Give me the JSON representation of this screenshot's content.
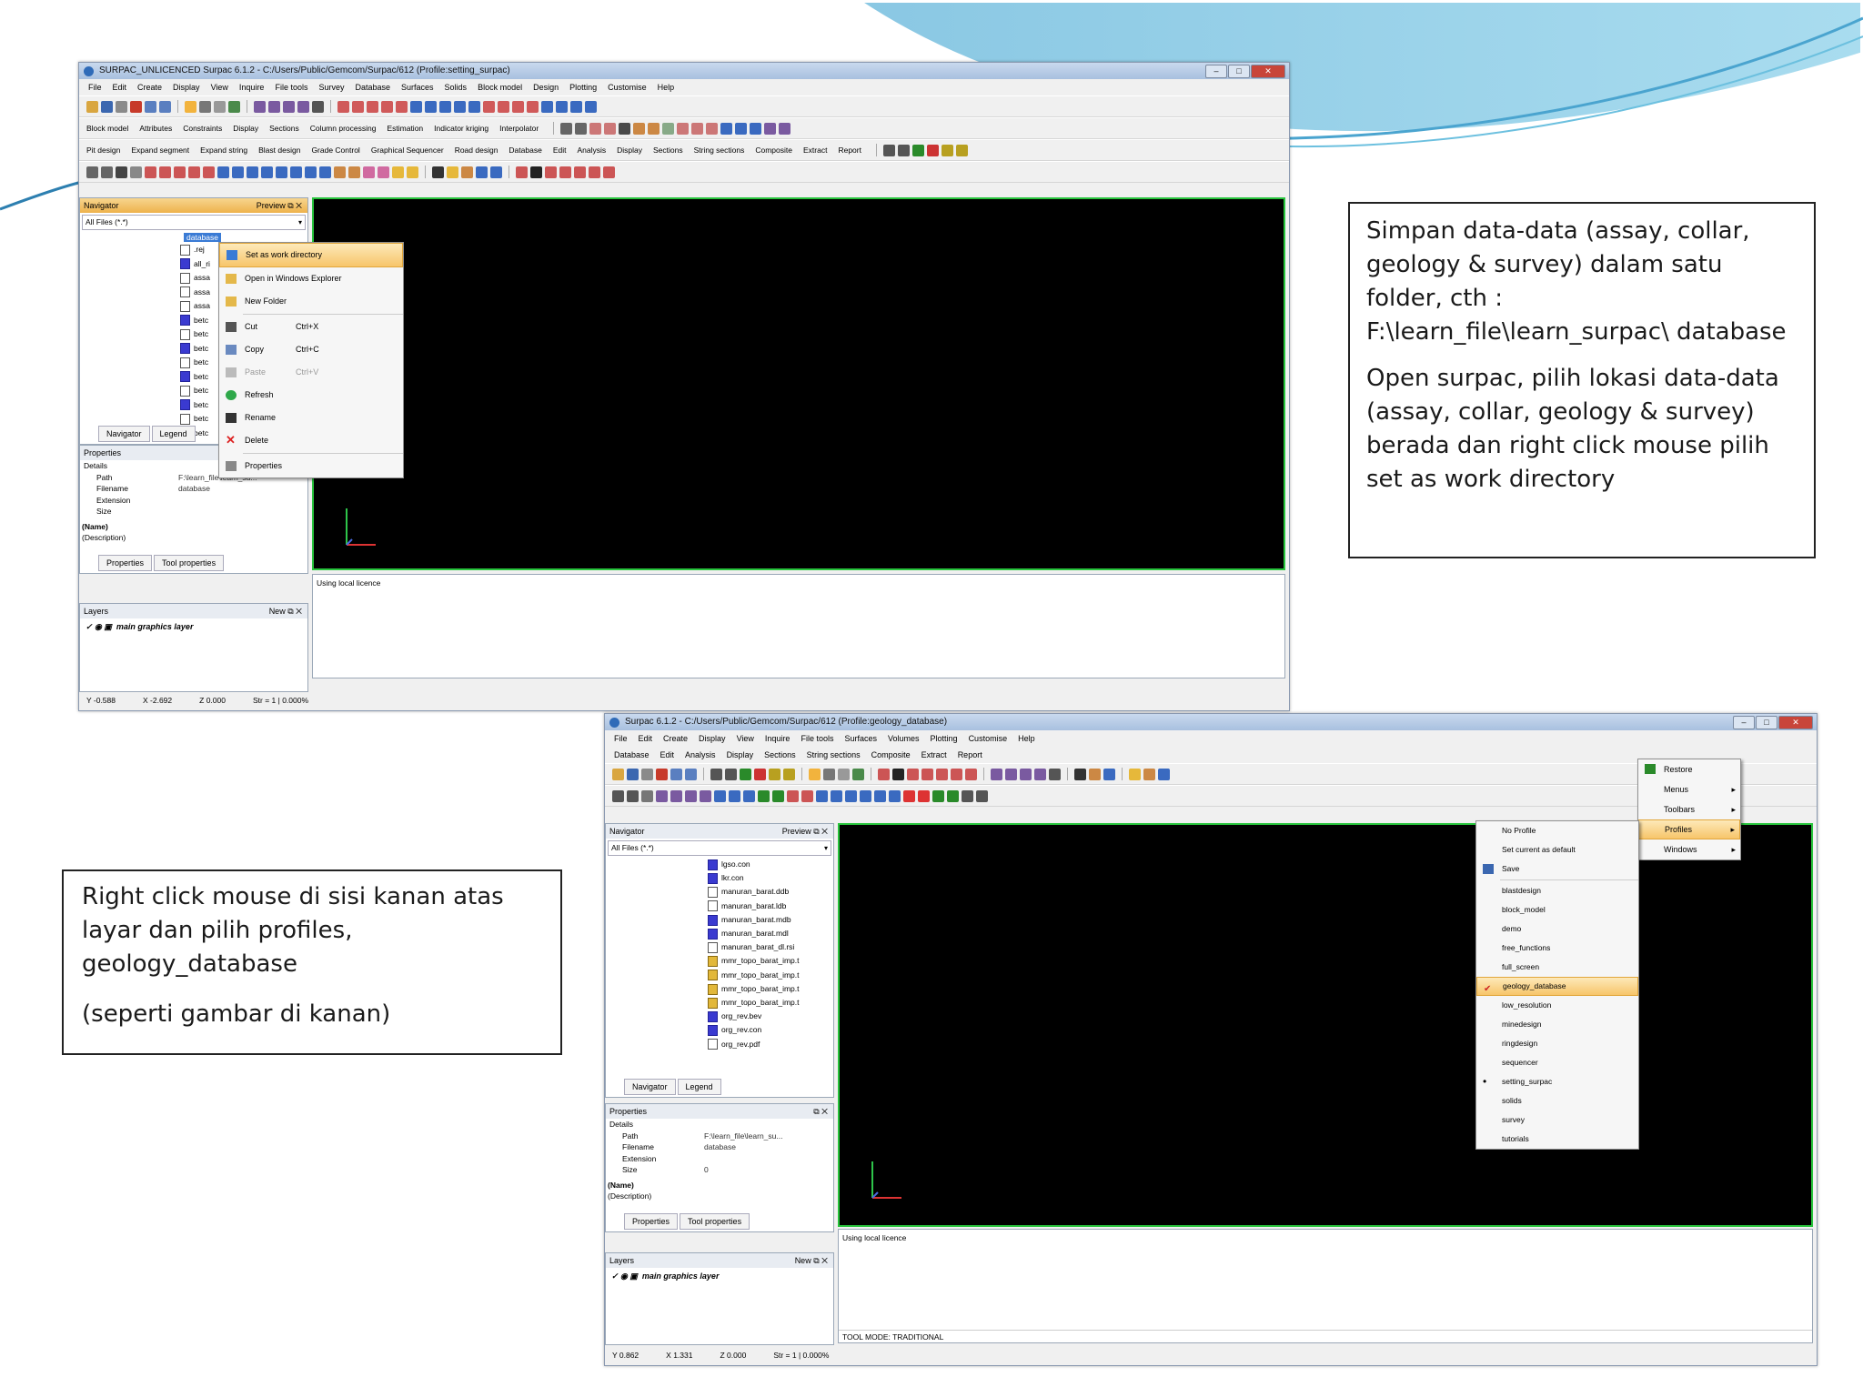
{
  "colors": {
    "wave_light": "#c7e9f5",
    "wave_mid": "#79c3df",
    "graphics_border": "#27c43c",
    "menu_highlight": "#f7c56a"
  },
  "window1": {
    "title": "SURPAC_UNLICENCED Surpac 6.1.2 - C:/Users/Public/Gemcom/Surpac/612 (Profile:setting_surpac)",
    "menus": [
      "File",
      "Edit",
      "Create",
      "Display",
      "View",
      "Inquire",
      "File tools",
      "Survey",
      "Database",
      "Surfaces",
      "Solids",
      "Block model",
      "Design",
      "Plotting",
      "Customise",
      "Help"
    ],
    "toolbar_row3": [
      "Block model",
      "Attributes",
      "Constraints",
      "Display",
      "Sections",
      "Column processing",
      "Estimation",
      "Indicator kriging",
      "Interpolator"
    ],
    "toolbar_row4": [
      "Pit design",
      "Expand segment",
      "Expand string",
      "Blast design",
      "Grade Control",
      "Graphical Sequencer",
      "Road design",
      "Database",
      "Edit",
      "Analysis",
      "Display",
      "Sections",
      "String sections",
      "Composite",
      "Extract",
      "Report"
    ],
    "navigator": {
      "title": "Navigator",
      "preview": "Preview",
      "filter": "All Files (*.*)",
      "folder": "database",
      "files": [
        ".rej",
        "all_ri",
        "assa",
        "assa",
        "assa",
        "betc",
        "betc",
        "betc",
        "betc",
        "betc",
        "betc",
        "betc",
        "betc",
        "betc"
      ]
    },
    "context_menu": {
      "items": [
        {
          "label": "Set as work directory",
          "shortcut": "",
          "highlight": true,
          "disabled": false
        },
        {
          "label": "Open in Windows Explorer",
          "shortcut": "",
          "highlight": false,
          "disabled": false
        },
        {
          "label": "New Folder",
          "shortcut": "",
          "highlight": false,
          "disabled": false
        },
        {
          "label": "Cut",
          "shortcut": "Ctrl+X",
          "highlight": false,
          "disabled": false
        },
        {
          "label": "Copy",
          "shortcut": "Ctrl+C",
          "highlight": false,
          "disabled": false
        },
        {
          "label": "Paste",
          "shortcut": "Ctrl+V",
          "highlight": false,
          "disabled": true
        },
        {
          "label": "Refresh",
          "shortcut": "",
          "highlight": false,
          "disabled": false
        },
        {
          "label": "Rename",
          "shortcut": "",
          "highlight": false,
          "disabled": false
        },
        {
          "label": "Delete",
          "shortcut": "",
          "highlight": false,
          "disabled": false
        },
        {
          "label": "Properties",
          "shortcut": "",
          "highlight": false,
          "disabled": false
        }
      ]
    },
    "nav_tabs": [
      "Navigator",
      "Legend"
    ],
    "properties": {
      "title": "Properties",
      "section": "Details",
      "rows": [
        {
          "key": "Path",
          "value": "F:\\learn_file\\learn_su..."
        },
        {
          "key": "Filename",
          "value": "database"
        },
        {
          "key": "Extension",
          "value": ""
        },
        {
          "key": "Size",
          "value": ""
        }
      ],
      "name_label": "(Name)",
      "desc_label": "(Description)",
      "tabs": [
        "Properties",
        "Tool properties"
      ]
    },
    "layers": {
      "title": "Layers",
      "new": "New",
      "item": "main graphics layer"
    },
    "console_text": "Using local licence",
    "status": {
      "x": "-0.588",
      "y": "-2.692",
      "z": "0.000",
      "scale": "Str = 1",
      "pct": "0.000%"
    }
  },
  "window2": {
    "title": "Surpac 6.1.2 - C:/Users/Public/Gemcom/Surpac/612 (Profile:geology_database)",
    "menus": [
      "File",
      "Edit",
      "Create",
      "Display",
      "View",
      "Inquire",
      "File tools",
      "Surfaces",
      "Volumes",
      "Plotting",
      "Customise",
      "Help"
    ],
    "menus2": [
      "Database",
      "Edit",
      "Analysis",
      "Display",
      "Sections",
      "String sections",
      "Composite",
      "Extract",
      "Report"
    ],
    "navigator": {
      "title": "Navigator",
      "preview": "Preview",
      "filter": "All Files (*.*)",
      "files": [
        "lgso.con",
        "lkr.con",
        "manuran_barat.ddb",
        "manuran_barat.ldb",
        "manuran_barat.mdb",
        "manuran_barat.mdl",
        "manuran_barat_dl.rsi",
        "mmr_topo_barat_imp.t",
        "mmr_topo_barat_imp.t",
        "mmr_topo_barat_imp.t",
        "mmr_topo_barat_imp.t",
        "org_rev.bev",
        "org_rev.con",
        "org_rev.pdf"
      ],
      "tabs": [
        "Navigator",
        "Legend"
      ]
    },
    "properties": {
      "title": "Properties",
      "section": "Details",
      "rows": [
        {
          "key": "Path",
          "value": "F:\\learn_file\\learn_su..."
        },
        {
          "key": "Filename",
          "value": "database"
        },
        {
          "key": "Extension",
          "value": ""
        },
        {
          "key": "Size",
          "value": "0"
        }
      ],
      "name_label": "(Name)",
      "desc_label": "(Description)",
      "tabs": [
        "Properties",
        "Tool properties"
      ]
    },
    "layers": {
      "title": "Layers",
      "new": "New",
      "item": "main graphics layer"
    },
    "console_text": "Using local licence",
    "console_status": "TOOL MODE: TRADITIONAL",
    "status": {
      "x": "0.862",
      "y": "1.331",
      "z": "0.000",
      "scale": "Str = 1",
      "pct": "0.000%"
    },
    "customise_menu": [
      "Restore",
      "Menus",
      "Toolbars",
      "Profiles",
      "Windows"
    ],
    "profiles_menu": [
      {
        "label": "No Profile",
        "check": false,
        "dot": false
      },
      {
        "label": "Set current as default",
        "check": false,
        "dot": false
      },
      {
        "label": "Save",
        "check": false,
        "dot": false
      },
      {
        "label": "blastdesign",
        "check": false,
        "dot": false
      },
      {
        "label": "block_model",
        "check": false,
        "dot": false
      },
      {
        "label": "demo",
        "check": false,
        "dot": false
      },
      {
        "label": "free_functions",
        "check": false,
        "dot": false
      },
      {
        "label": "full_screen",
        "check": false,
        "dot": false
      },
      {
        "label": "geology_database",
        "check": true,
        "dot": false
      },
      {
        "label": "low_resolution",
        "check": false,
        "dot": false
      },
      {
        "label": "minedesign",
        "check": false,
        "dot": false
      },
      {
        "label": "ringdesign",
        "check": false,
        "dot": false
      },
      {
        "label": "sequencer",
        "check": false,
        "dot": false
      },
      {
        "label": "setting_surpac",
        "check": false,
        "dot": true
      },
      {
        "label": "solids",
        "check": false,
        "dot": false
      },
      {
        "label": "survey",
        "check": false,
        "dot": false
      },
      {
        "label": "tutorials",
        "check": false,
        "dot": false
      }
    ]
  },
  "callout1": {
    "p1": "Simpan data-data (assay, collar, geology & survey) dalam satu folder, cth : F:\\learn_file\\learn_surpac\\ database",
    "p2": "Open surpac, pilih lokasi data-data (assay, collar, geology & survey) berada dan right click mouse pilih set as work directory"
  },
  "callout2": {
    "p1": "Right click mouse di sisi kanan atas layar dan pilih profiles, geology_database",
    "p2": "(seperti gambar di kanan)"
  }
}
